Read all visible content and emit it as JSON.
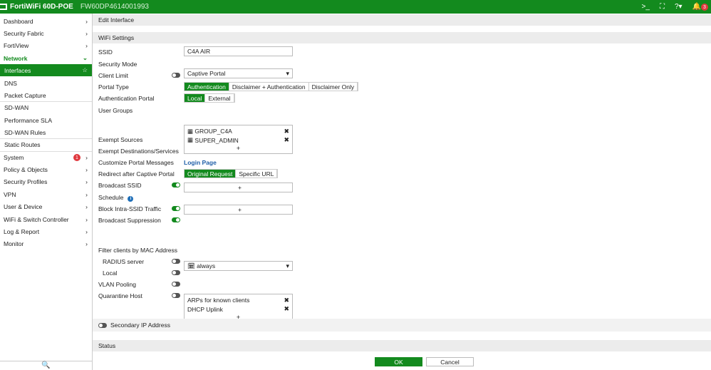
{
  "header": {
    "brand": "FortiWiFi 60D-POE",
    "serial": "FW60DP4614001993",
    "notification_count": "3"
  },
  "sidebar": {
    "items": [
      {
        "label": "Dashboard"
      },
      {
        "label": "Security Fabric"
      },
      {
        "label": "FortiView"
      },
      {
        "label": "Network"
      },
      {
        "label": "Interfaces"
      },
      {
        "label": "DNS"
      },
      {
        "label": "Packet Capture"
      },
      {
        "label": "SD-WAN"
      },
      {
        "label": "Performance SLA"
      },
      {
        "label": "SD-WAN Rules"
      },
      {
        "label": "Static Routes"
      },
      {
        "label": "System",
        "badge": "1"
      },
      {
        "label": "Policy & Objects"
      },
      {
        "label": "Security Profiles"
      },
      {
        "label": "VPN"
      },
      {
        "label": "User & Device"
      },
      {
        "label": "WiFi & Switch Controller"
      },
      {
        "label": "Log & Report"
      },
      {
        "label": "Monitor"
      }
    ]
  },
  "main": {
    "title": "Edit Interface",
    "section": "WiFi Settings",
    "ssid_label": "SSID",
    "ssid": "C4A AIR",
    "security_mode_label": "Security Mode",
    "security_mode": "Captive Portal",
    "client_limit_label": "Client Limit",
    "portal_type_label": "Portal Type",
    "portal_types": [
      "Authentication",
      "Disclaimer + Authentication",
      "Disclaimer Only"
    ],
    "auth_portal_label": "Authentication Portal",
    "auth_portals": [
      "Local",
      "External"
    ],
    "user_groups_label": "User Groups",
    "user_groups": [
      "GROUP_C4A",
      "SUPER_ADMIN"
    ],
    "exempt_sources_label": "Exempt Sources",
    "exempt_dest_label": "Exempt Destinations/Services",
    "customize_label": "Customize Portal Messages",
    "login_page": "Login Page",
    "redirect_label": "Redirect after Captive Portal",
    "redirect_options": [
      "Original Request",
      "Specific URL"
    ],
    "broadcast_ssid_label": "Broadcast SSID",
    "schedule_label": "Schedule",
    "schedule": "always",
    "block_intra_label": "Block Intra-SSID Traffic",
    "broadcast_suppression_label": "Broadcast Suppression",
    "suppression_items": [
      "ARPs for known clients",
      "DHCP Uplink"
    ],
    "filter_mac_label": "Filter clients by MAC Address",
    "radius_label": "RADIUS server",
    "local_label": "Local",
    "vlan_pooling_label": "VLAN Pooling",
    "quarantine_label": "Quarantine Host",
    "secondary_ip_label": "Secondary IP Address",
    "status_label": "Status",
    "plus": "+",
    "remove": "✖"
  },
  "footer": {
    "ok": "OK",
    "cancel": "Cancel"
  }
}
